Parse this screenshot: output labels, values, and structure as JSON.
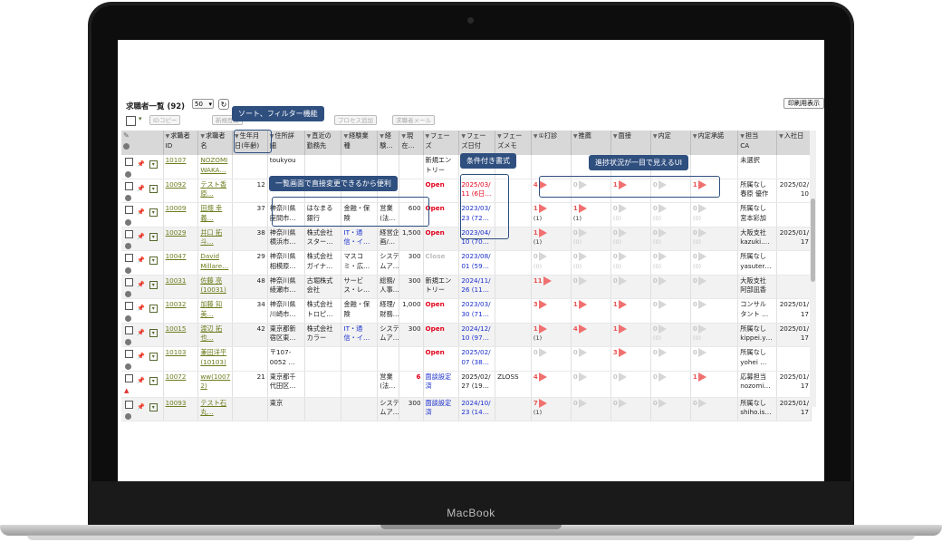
{
  "device": {
    "brand": "MacBook"
  },
  "page": {
    "title": "求職者一覧 (92)",
    "per_page": "50",
    "refresh_icon": "↻",
    "print_button": "印刷用表示",
    "toolbar": {
      "check_dropdown": "▾",
      "buttons": [
        "IDコピー",
        "新規登録",
        "プロセス追加",
        "求職者メール"
      ]
    }
  },
  "callouts": {
    "sort_filter": "ソート、フィルター機能",
    "inline_edit": "一覧画面で直接変更できるから便利",
    "conditional_format": "条件付き書式",
    "progress": "進捗状況が一目で見えるUI"
  },
  "columns": [
    "求職者ID",
    "求職者名",
    "生年月日(年齢)",
    "住所詳細",
    "直近の勤務先",
    "経験業種",
    "経験職",
    "現在年収",
    "フェーズ",
    "フェーズ日付",
    "フェーズメモ",
    "①打診",
    "推薦",
    "面接",
    "内定",
    "内定承諾",
    "担当CA",
    "入社日"
  ],
  "header_labels": [
    [
      "求職者",
      "ID"
    ],
    [
      "求職者",
      "名"
    ],
    [
      "生年月",
      "日(年齢)"
    ],
    [
      "住所詳",
      "細"
    ],
    [
      "直近の",
      "勤務先"
    ],
    [
      "経験業",
      "種"
    ],
    [
      "経",
      "験…"
    ],
    [
      "現",
      "在…"
    ],
    [
      "フェー",
      "ズ"
    ],
    [
      "フェー",
      "ズ日付"
    ],
    [
      "フェー",
      "ズメモ"
    ],
    [
      "①打診",
      ""
    ],
    [
      "推薦",
      ""
    ],
    [
      "面接",
      ""
    ],
    [
      "内定",
      ""
    ],
    [
      "内定承諾",
      ""
    ],
    [
      "担当",
      "CA"
    ],
    [
      "入社日",
      ""
    ]
  ],
  "rows": [
    {
      "id": "10107",
      "name": [
        "NOZOMI",
        "WAKA…"
      ],
      "age": "",
      "addr": [
        "toukyou",
        ""
      ],
      "employer": [
        "",
        ""
      ],
      "industry": [
        "",
        ""
      ],
      "job": [
        "",
        ""
      ],
      "salary": "",
      "phase": [
        "",
        "新規エン",
        "トリー"
      ],
      "phase_date": [
        "",
        ""
      ],
      "memo": "",
      "progress": [
        null,
        null,
        null,
        null,
        null
      ],
      "ca": [
        "未選択",
        ""
      ],
      "start": [
        "",
        ""
      ],
      "warn": false,
      "alt": false
    },
    {
      "id": "10092",
      "name": [
        "テスト香",
        "原…"
      ],
      "age": "12",
      "addr": [
        "",
        ""
      ],
      "employer": [
        "",
        ""
      ],
      "industry": [
        "",
        ""
      ],
      "job": [
        "",
        ""
      ],
      "salary": "",
      "phase": [
        "Open",
        "",
        ""
      ],
      "phase_date": [
        "2025/03/",
        "11 (6日…"
      ],
      "date_red": true,
      "memo": "",
      "progress": [
        [
          "4",
          ""
        ],
        [
          "0",
          ""
        ],
        [
          "1",
          ""
        ],
        [
          "0",
          ""
        ],
        [
          "1",
          ""
        ]
      ],
      "ca": [
        "所属なし",
        "春原 優作"
      ],
      "start": [
        "2025/02/",
        "10"
      ],
      "warn": false,
      "alt": false
    },
    {
      "id": "10009",
      "name": [
        "田畑 幸",
        "義…"
      ],
      "age": "37",
      "addr": [
        "神奈川県",
        "座間市…"
      ],
      "employer": [
        "はなまる",
        "銀行"
      ],
      "industry": [
        "金融・保",
        "険"
      ],
      "job": [
        "営業",
        "(法…"
      ],
      "salary": "600",
      "phase": [
        "Open",
        "",
        ""
      ],
      "phase_date": [
        "2023/03/",
        "23 (72…"
      ],
      "memo": "",
      "progress": [
        [
          "1",
          "(1)"
        ],
        [
          "1",
          "(1)"
        ],
        [
          "0",
          "(0)"
        ],
        [
          "0",
          "(0)"
        ],
        [
          "0",
          "(0)"
        ]
      ],
      "ca": [
        "所属なし",
        "宮本彩加"
      ],
      "start": [
        "",
        ""
      ],
      "warn": false,
      "alt": false
    },
    {
      "id": "10029",
      "name": [
        "井口 拓",
        "斗…"
      ],
      "age": "38",
      "addr": [
        "神奈川県",
        "横浜市…"
      ],
      "employer": [
        "株式会社",
        "スター…"
      ],
      "industry": [
        "IT・通",
        "信・イ…"
      ],
      "industry_blue": true,
      "job": [
        "経営企",
        "画/…"
      ],
      "salary": "1,500",
      "phase": [
        "Open",
        "",
        ""
      ],
      "phase_date": [
        "2023/04/",
        "10 (70…"
      ],
      "memo": "",
      "progress": [
        [
          "1",
          "(1)"
        ],
        [
          "0",
          "(0)"
        ],
        [
          "0",
          "(0)"
        ],
        [
          "0",
          "(0)"
        ],
        [
          "0",
          "(0)"
        ]
      ],
      "ca": [
        "大阪支社",
        "kazuki.…"
      ],
      "start": [
        "2025/01/",
        "17"
      ],
      "warn": false,
      "alt": true
    },
    {
      "id": "10047",
      "name": [
        "David",
        "Millare…"
      ],
      "age": "29",
      "addr": [
        "神奈川県",
        "相模原…"
      ],
      "employer": [
        "株式会社",
        "ガイナ…"
      ],
      "industry": [
        "マスコ",
        "ミ・広…"
      ],
      "job": [
        "システ",
        "ムア…"
      ],
      "salary": "300",
      "phase": [
        "Close",
        "",
        ""
      ],
      "phase_date": [
        "2023/08/",
        "01 (59…"
      ],
      "memo": "",
      "progress": [
        [
          "0",
          "(0)"
        ],
        [
          "0",
          "(0)"
        ],
        [
          "0",
          "(0)"
        ],
        [
          "0",
          "(0)"
        ],
        [
          "0",
          "(0)"
        ]
      ],
      "ca": [
        "所属なし",
        "yasuter…"
      ],
      "start": [
        "",
        ""
      ],
      "warn": false,
      "alt": false
    },
    {
      "id": "10031",
      "name": [
        "佐藤 亮",
        "(10031)"
      ],
      "age": "48",
      "addr": [
        "神奈川県",
        "綾瀬市…"
      ],
      "employer": [
        "古堀株式",
        "会社"
      ],
      "industry": [
        "サービ",
        "ス・レ…"
      ],
      "job": [
        "総務/",
        "人事…"
      ],
      "salary": "300",
      "phase": [
        "",
        "新規エン",
        "トリー"
      ],
      "phase_date": [
        "2024/11/",
        "26 (11…"
      ],
      "memo": "",
      "progress": [
        [
          "11",
          ""
        ],
        [
          "0",
          ""
        ],
        [
          "0",
          ""
        ],
        [
          "0",
          ""
        ],
        [
          "0",
          ""
        ]
      ],
      "ca": [
        "大阪支社",
        "阿部凪香"
      ],
      "start": [
        "",
        ""
      ],
      "warn": false,
      "alt": true
    },
    {
      "id": "10032",
      "name": [
        "加藤 知",
        "美…"
      ],
      "age": "34",
      "addr": [
        "神奈川県",
        "川崎市…"
      ],
      "employer": [
        "株式会社",
        "トロピ…"
      ],
      "industry": [
        "金融・保",
        "険"
      ],
      "job": [
        "経理/",
        "財務…"
      ],
      "salary": "1,000",
      "phase": [
        "Open",
        "",
        ""
      ],
      "phase_date": [
        "2023/03/",
        "30 (71…"
      ],
      "memo": "",
      "progress": [
        [
          "3",
          ""
        ],
        [
          "1",
          ""
        ],
        [
          "1",
          ""
        ],
        [
          "0",
          ""
        ],
        [
          "0",
          ""
        ]
      ],
      "ca": [
        "コンサル",
        "タント …"
      ],
      "start": [
        "2025/01/",
        "17"
      ],
      "warn": false,
      "alt": false
    },
    {
      "id": "10015",
      "name": [
        "渡辺 拓",
        "也…"
      ],
      "age": "42",
      "addr": [
        "東京都新",
        "宿区東…"
      ],
      "employer": [
        "株式会社",
        "カラー"
      ],
      "industry": [
        "IT・通",
        "信・イ…"
      ],
      "industry_blue": true,
      "job": [
        "システ",
        "ムア…"
      ],
      "salary": "300",
      "phase": [
        "Open",
        "",
        ""
      ],
      "phase_date": [
        "2024/12/",
        "10 (97…"
      ],
      "memo": "",
      "progress": [
        [
          "1",
          "(1)"
        ],
        [
          "4",
          ""
        ],
        [
          "1",
          ""
        ],
        [
          "0",
          "(0)"
        ],
        [
          "0",
          "(0)"
        ]
      ],
      "ca": [
        "所属なし",
        "kippei.y…"
      ],
      "start": [
        "2025/01/",
        "17"
      ],
      "warn": false,
      "alt": true
    },
    {
      "id": "10103",
      "name": [
        "兼田洋平",
        "(10103)"
      ],
      "age": "",
      "addr": [
        "〒107-",
        "0052 …"
      ],
      "employer": [
        "",
        ""
      ],
      "industry": [
        "",
        ""
      ],
      "job": [
        "",
        ""
      ],
      "salary": "",
      "phase": [
        "Open",
        "",
        ""
      ],
      "phase_date": [
        "2025/02/",
        "07 (38…"
      ],
      "memo": "",
      "progress": [
        [
          "0",
          ""
        ],
        [
          "0",
          ""
        ],
        [
          "3",
          ""
        ],
        [
          "0",
          ""
        ],
        [
          "0",
          ""
        ]
      ],
      "ca": [
        "所属なし",
        "yohei …"
      ],
      "start": [
        "",
        ""
      ],
      "warn": false,
      "alt": false
    },
    {
      "id": "10072",
      "name": [
        "ww(1007",
        "2)"
      ],
      "age": "21",
      "addr": [
        "東京都千",
        "代田区…"
      ],
      "employer": [
        "",
        ""
      ],
      "industry": [
        "",
        ""
      ],
      "job": [
        "営業",
        "(法…"
      ],
      "salary": "6",
      "salary_red": true,
      "phase": [
        "",
        "面談設定",
        "済"
      ],
      "phase_blue": true,
      "phase_date": [
        "2025/02/",
        "27 (19…"
      ],
      "date_dark": true,
      "memo": "ZLOSS",
      "progress": [
        [
          "4",
          ""
        ],
        [
          "0",
          ""
        ],
        [
          "0",
          ""
        ],
        [
          "0",
          ""
        ],
        [
          "1",
          ""
        ]
      ],
      "ca": [
        "応募担当",
        "nozomi…"
      ],
      "start": [
        "2025/01/",
        "17"
      ],
      "warn": true,
      "alt": false
    },
    {
      "id": "10093",
      "name": [
        "テスト石",
        "丸…"
      ],
      "age": "",
      "addr": [
        "東京",
        ""
      ],
      "employer": [
        "",
        ""
      ],
      "industry": [
        "",
        ""
      ],
      "job": [
        "システ",
        "ムア…"
      ],
      "salary": "300",
      "phase": [
        "",
        "面談設定",
        "済"
      ],
      "phase_blue": true,
      "phase_date": [
        "2024/10/",
        "23 (14…"
      ],
      "memo": "",
      "progress": [
        [
          "7",
          "(1)"
        ],
        [
          "0",
          ""
        ],
        [
          "0",
          ""
        ],
        [
          "0",
          ""
        ],
        [
          "0",
          ""
        ]
      ],
      "ca": [
        "所属なし",
        "shiho.is…"
      ],
      "start": [
        "2025/01/",
        "17"
      ],
      "warn": false,
      "alt": true
    }
  ]
}
